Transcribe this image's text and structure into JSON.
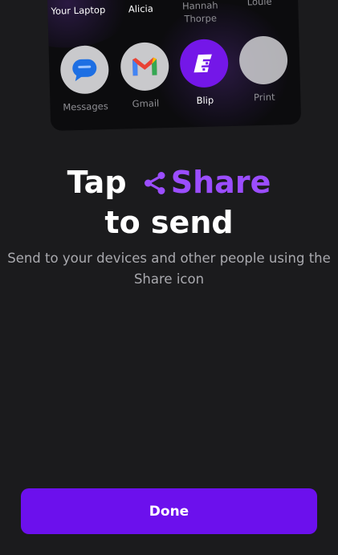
{
  "share_sheet": {
    "targets": [
      {
        "label": "Your Laptop",
        "icon": "laptop-icon"
      },
      {
        "label": "Alicia",
        "icon": "person-avatar"
      },
      {
        "label": "Hannah Thorpe",
        "icon": "person-avatar"
      },
      {
        "label": "Louie",
        "icon": "person-avatar"
      }
    ],
    "apps": [
      {
        "label": "Messages",
        "icon": "messages-icon"
      },
      {
        "label": "Gmail",
        "icon": "gmail-icon"
      },
      {
        "label": "Blip",
        "icon": "blip-logo-icon"
      },
      {
        "label": "Print",
        "icon": "print-icon"
      }
    ]
  },
  "headline": {
    "line1_prefix": "Tap",
    "share_word": "Share",
    "line2": "to send"
  },
  "subtitle": "Send to your devices and other people using the Share icon",
  "done_button": "Done",
  "colors": {
    "background": "#1b1b1d",
    "card": "#0c0c0e",
    "accent": "#6c10ed",
    "accent_text": "#9b4dff",
    "muted_text": "#a9a9ae"
  }
}
